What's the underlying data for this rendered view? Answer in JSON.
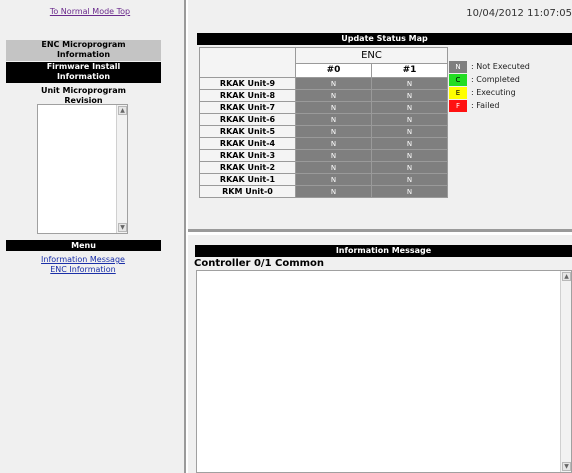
{
  "left": {
    "top_link": "To Normal Mode Top",
    "enc_micro_line1": "ENC Microprogram",
    "enc_micro_line2": "Information",
    "fw_install_line1": "Firmware Install",
    "fw_install_line2": "Information",
    "unit_micro_line1": "Unit Microprogram",
    "unit_micro_line2": "Revision",
    "menu_title": "Menu",
    "menu_items": [
      "Information Message",
      "ENC Information"
    ]
  },
  "timestamp": "10/04/2012 11:07:05",
  "status_map": {
    "title": "Update Status Map",
    "group_header": "ENC",
    "columns": [
      "#0",
      "#1"
    ],
    "rows": [
      {
        "label": "RKAK Unit-9",
        "cells": [
          "N",
          "N"
        ]
      },
      {
        "label": "RKAK Unit-8",
        "cells": [
          "N",
          "N"
        ]
      },
      {
        "label": "RKAK Unit-7",
        "cells": [
          "N",
          "N"
        ]
      },
      {
        "label": "RKAK Unit-6",
        "cells": [
          "N",
          "N"
        ]
      },
      {
        "label": "RKAK Unit-5",
        "cells": [
          "N",
          "N"
        ]
      },
      {
        "label": "RKAK Unit-4",
        "cells": [
          "N",
          "N"
        ]
      },
      {
        "label": "RKAK Unit-3",
        "cells": [
          "N",
          "N"
        ]
      },
      {
        "label": "RKAK Unit-2",
        "cells": [
          "N",
          "N"
        ]
      },
      {
        "label": "RKAK Unit-1",
        "cells": [
          "N",
          "N"
        ]
      },
      {
        "label": "RKM Unit-0",
        "cells": [
          "N",
          "N"
        ]
      }
    ]
  },
  "legend": [
    {
      "code": "N",
      "text": ": Not Executed",
      "color": "#7f7f7f",
      "text_color": "#ffffff"
    },
    {
      "code": "C",
      "text": ": Completed",
      "color": "#22dd22",
      "text_color": "#000000"
    },
    {
      "code": "E",
      "text": ": Executing",
      "color": "#ffff00",
      "text_color": "#000000"
    },
    {
      "code": "F",
      "text": ": Failed",
      "color": "#ff1111",
      "text_color": "#ffffff"
    }
  ],
  "info_message": {
    "title": "Information Message",
    "controller_label": "Controller 0/1 Common",
    "body": ""
  }
}
